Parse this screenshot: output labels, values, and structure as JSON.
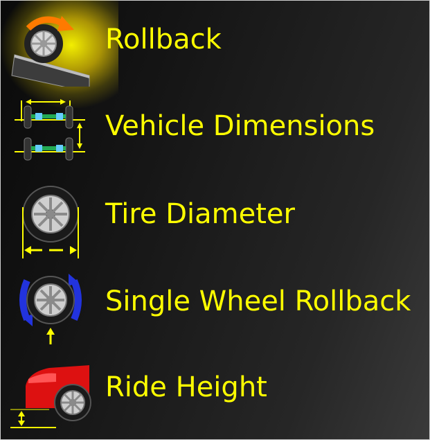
{
  "menu": {
    "items": [
      {
        "id": "rollback",
        "label": "Rollback",
        "icon": "rollback-icon"
      },
      {
        "id": "vehicle-dimensions",
        "label": "Vehicle Dimensions",
        "icon": "vehicle-dimensions-icon"
      },
      {
        "id": "tire-diameter",
        "label": "Tire Diameter",
        "icon": "tire-diameter-icon"
      },
      {
        "id": "single-wheel-rollback",
        "label": "Single Wheel Rollback",
        "icon": "single-wheel-rollback-icon"
      },
      {
        "id": "ride-height",
        "label": "Ride Height",
        "icon": "ride-height-icon"
      }
    ],
    "selected": "rollback"
  },
  "colors": {
    "label": "#ffff00",
    "highlight": "#ffe800",
    "background_dark": "#0a0a0a",
    "background_light": "#3a3a3a",
    "arrow_blue": "#2233dd",
    "car_red": "#dd1111"
  }
}
